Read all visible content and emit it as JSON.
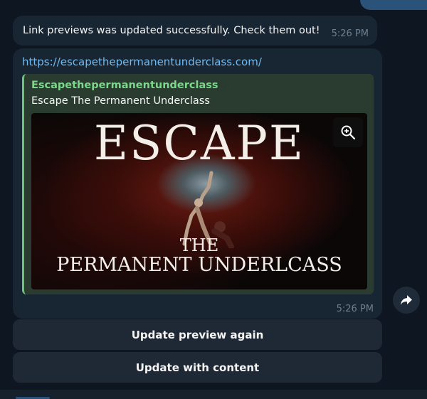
{
  "message1": {
    "text": "Link previews was updated successfully. Check them out!",
    "time": "5:26 PM"
  },
  "message2": {
    "url": "https://escapethepermanentunderclass.com/",
    "preview": {
      "site_name": "Escapethepermanentunderclass",
      "title": "Escape The Permanent Underclass",
      "image_text": {
        "line1": "ESCAPE",
        "line2": "THE",
        "line3": "PERMANENT UNDERLCASS"
      },
      "zoom_icon": "zoom-in-icon"
    },
    "time": "5:26 PM"
  },
  "share_icon": "share-arrow-icon",
  "buttons": {
    "update_preview": "Update preview again",
    "update_content": "Update with content"
  },
  "colors": {
    "background": "#0e1621",
    "bubble": "#182533",
    "link": "#71baf1",
    "site_name": "#7ad98a",
    "preview_border": "#6cc47b"
  }
}
